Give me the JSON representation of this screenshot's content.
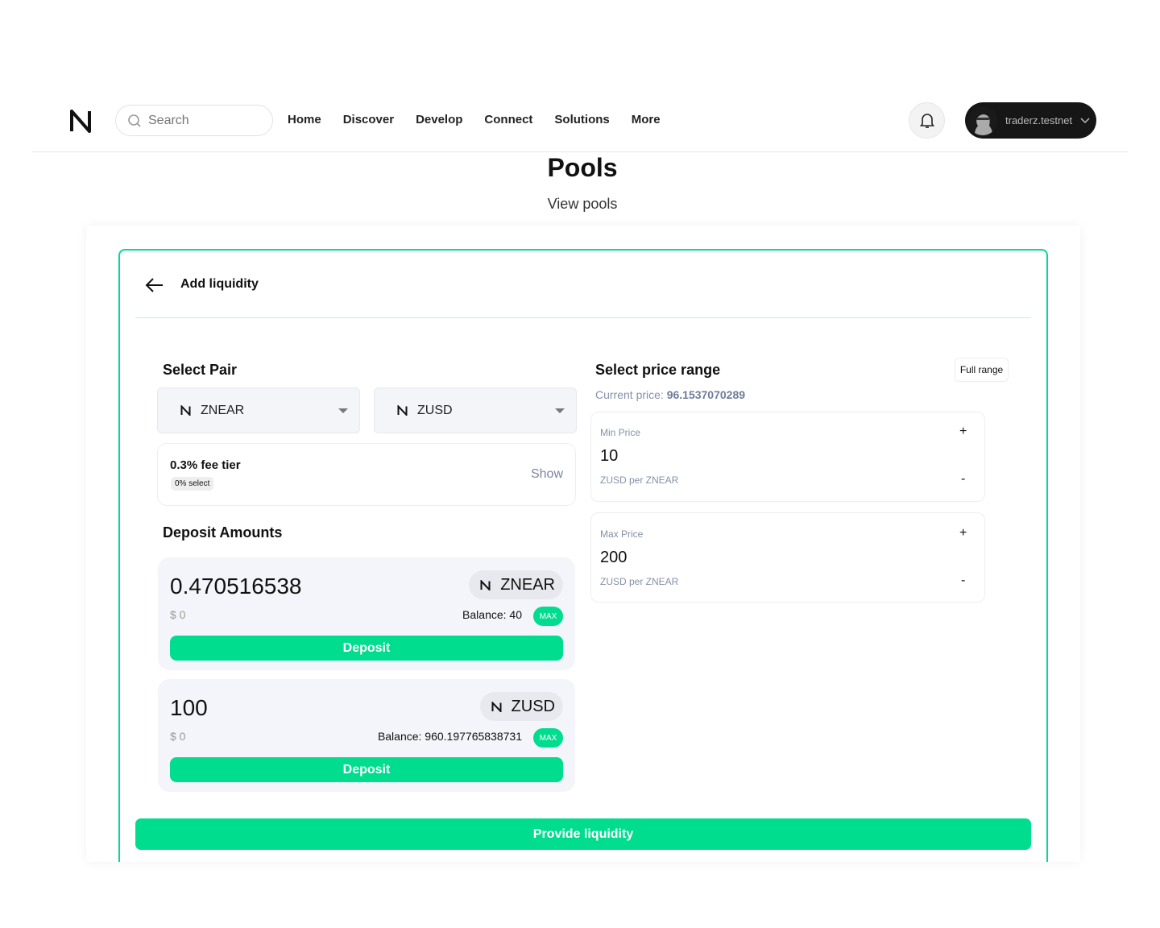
{
  "nav": {
    "search_placeholder": "Search",
    "items": [
      "Home",
      "Discover",
      "Develop",
      "Connect",
      "Solutions",
      "More"
    ],
    "account": "traderz.testnet"
  },
  "page": {
    "title": "Pools",
    "subtitle": "View pools"
  },
  "card": {
    "title": "Add liquidity",
    "select_pair": {
      "heading": "Select Pair",
      "token_a": "ZNEAR",
      "token_b": "ZUSD"
    },
    "fee": {
      "label": "0.3% fee tier",
      "badge": "0% select",
      "show": "Show"
    },
    "deposit": {
      "heading": "Deposit Amounts",
      "items": [
        {
          "amount": "0.470516538",
          "token": "ZNEAR",
          "usd": "$ 0",
          "balance": "Balance: 40",
          "max": "MAX",
          "button": "Deposit"
        },
        {
          "amount": "100",
          "token": "ZUSD",
          "usd": "$ 0",
          "balance": "Balance: 960.197765838731",
          "max": "MAX",
          "button": "Deposit"
        }
      ]
    },
    "price_range": {
      "heading": "Select price range",
      "full_range": "Full range",
      "current_label": "Current price: ",
      "current_value": "96.1537070289",
      "min": {
        "label": "Min Price",
        "value": "10",
        "unit": "ZUSD per ZNEAR"
      },
      "max": {
        "label": "Max Price",
        "value": "200",
        "unit": "ZUSD per ZNEAR"
      },
      "plus": "+",
      "minus": "-"
    },
    "provide": "Provide liquidity"
  },
  "colors": {
    "accent": "#00dd8f"
  }
}
